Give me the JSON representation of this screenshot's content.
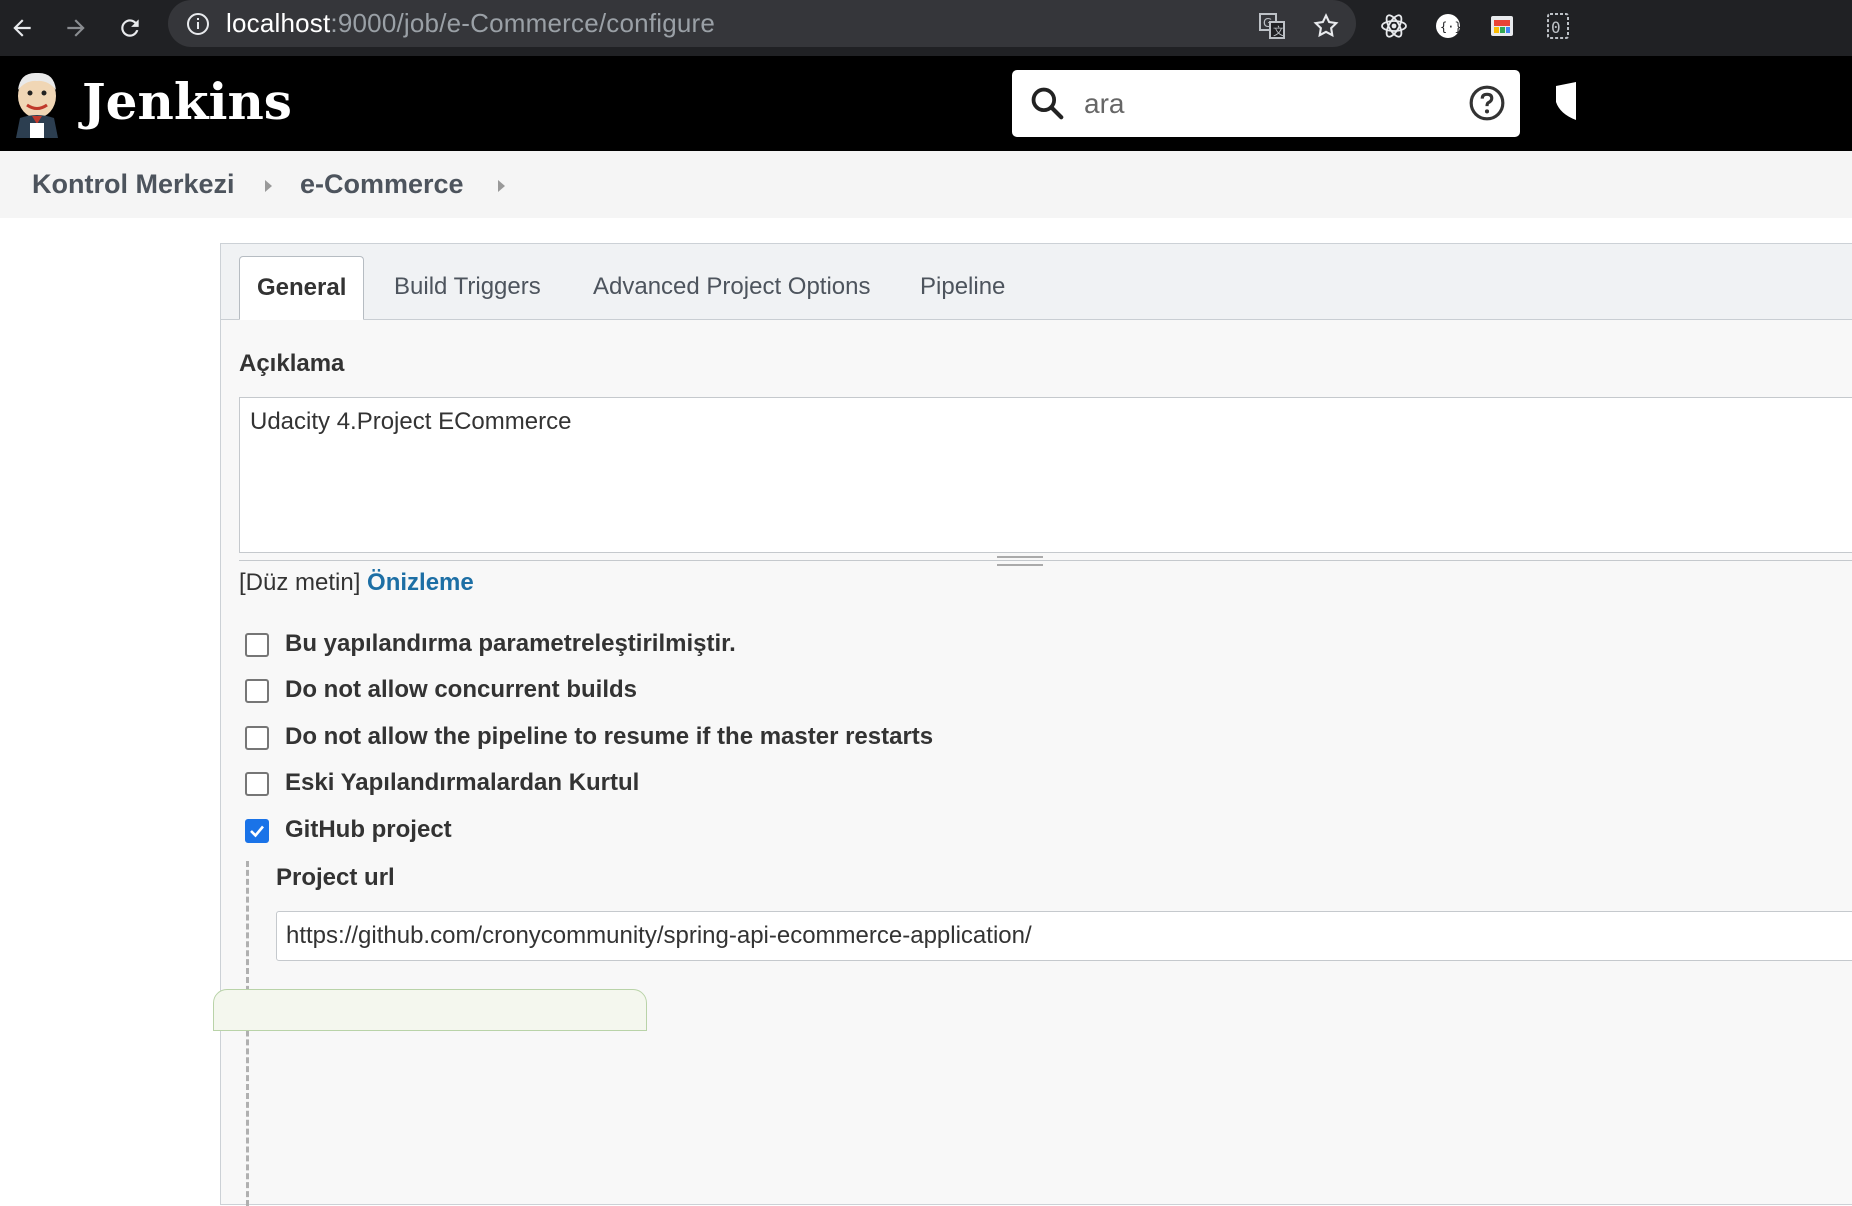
{
  "browser": {
    "url_host": "localhost",
    "url_path": ":9000/job/e-Commerce/configure",
    "colors": {
      "bar": "#202124",
      "pill": "#35363a"
    }
  },
  "header": {
    "brand": "Jenkins",
    "search": {
      "value": "ara"
    }
  },
  "breadcrumb": [
    "Kontrol Merkezi",
    "e-Commerce"
  ],
  "tabs": [
    {
      "label": "General",
      "active": true
    },
    {
      "label": "Build Triggers",
      "active": false
    },
    {
      "label": "Advanced Project Options",
      "active": false
    },
    {
      "label": "Pipeline",
      "active": false
    }
  ],
  "general": {
    "description_label": "Açıklama",
    "description_value": "Udacity 4.Project ECommerce",
    "format_plain": "[Düz metin]",
    "format_preview": "Önizleme",
    "options": [
      {
        "label": "Bu yapılandırma parametreleştirilmiştir.",
        "checked": false
      },
      {
        "label": "Do not allow concurrent builds",
        "checked": false
      },
      {
        "label": "Do not allow the pipeline to resume if the master restarts",
        "checked": false
      },
      {
        "label": "Eski Yapılandırmalardan Kurtul",
        "checked": false
      },
      {
        "label": "GitHub project",
        "checked": true
      }
    ],
    "project_url_label": "Project url",
    "project_url_value": "https://github.com/cronycommunity/spring-api-ecommerce-application/"
  },
  "colors": {
    "link": "#1d6fa5",
    "checkbox_checked": "#1a73e8",
    "header_bg": "#000000"
  }
}
